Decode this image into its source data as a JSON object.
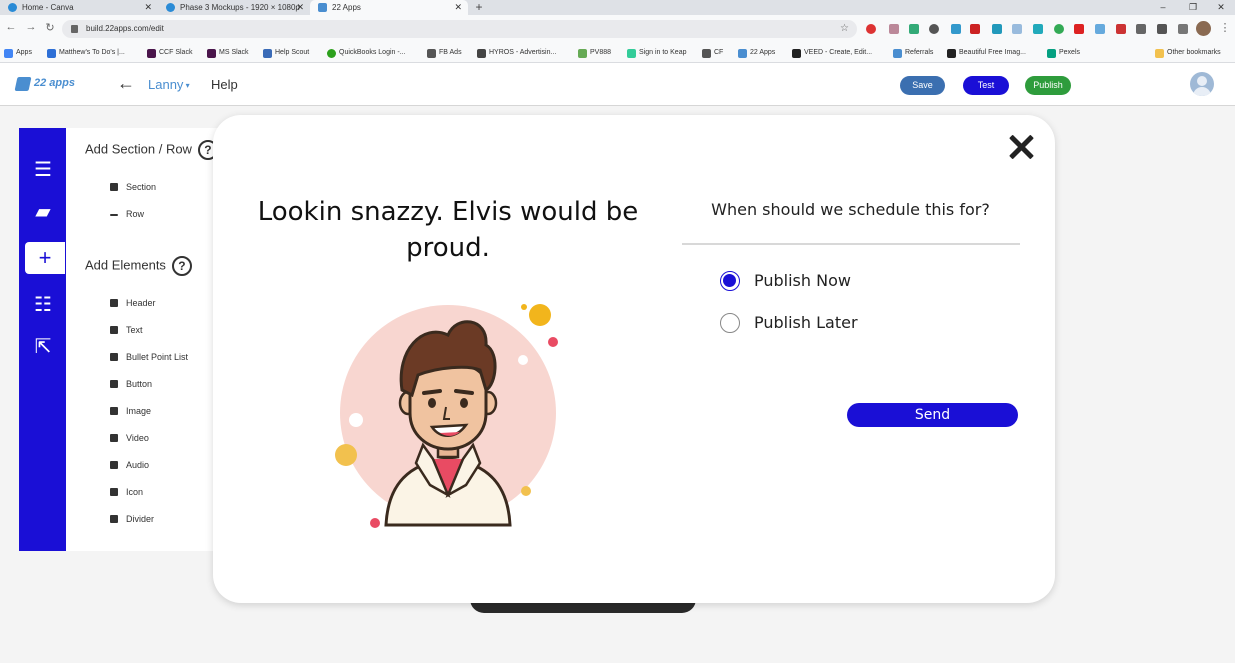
{
  "browser": {
    "tabs": [
      {
        "title": "Home - Canva"
      },
      {
        "title": "Phase 3 Mockups - 1920 × 1080p"
      },
      {
        "title": "22 Apps"
      }
    ],
    "url": "build.22apps.com/edit",
    "bookmarks": [
      "Apps",
      "Matthew's To Do's |...",
      "CCF Slack",
      "MS Slack",
      "Help Scout",
      "QuickBooks Login -...",
      "FB Ads",
      "HYROS - Advertisin...",
      "PV888",
      "Sign in to Keap",
      "CF",
      "22 Apps",
      "VEED - Create, Edit...",
      "Referrals",
      "Beautiful Free Imag...",
      "Pexels",
      "Other bookmarks"
    ]
  },
  "header": {
    "logo_text": "22 apps",
    "user_menu": "Lanny",
    "help": "Help",
    "save": "Save",
    "test": "Test",
    "publish": "Publish",
    "colors": {
      "save": "#3b6fb0",
      "test": "#1a0fd6",
      "publish": "#2e9c3c"
    }
  },
  "sidebar": {
    "add_section_title": "Add Section / Row",
    "section_items": [
      "Section",
      "Row"
    ],
    "add_elements_title": "Add Elements",
    "element_items": [
      "Header",
      "Text",
      "Bullet Point List",
      "Button",
      "Image",
      "Video",
      "Audio",
      "Icon",
      "Divider"
    ],
    "help_glyph": "?"
  },
  "modal": {
    "headline": "Lookin snazzy. Elvis would be proud.",
    "question": "When should we schedule this for?",
    "options": [
      {
        "label": "Publish Now",
        "selected": true
      },
      {
        "label": "Publish Later",
        "selected": false
      }
    ],
    "send_label": "Send",
    "accent_color": "#1a0fd6"
  }
}
